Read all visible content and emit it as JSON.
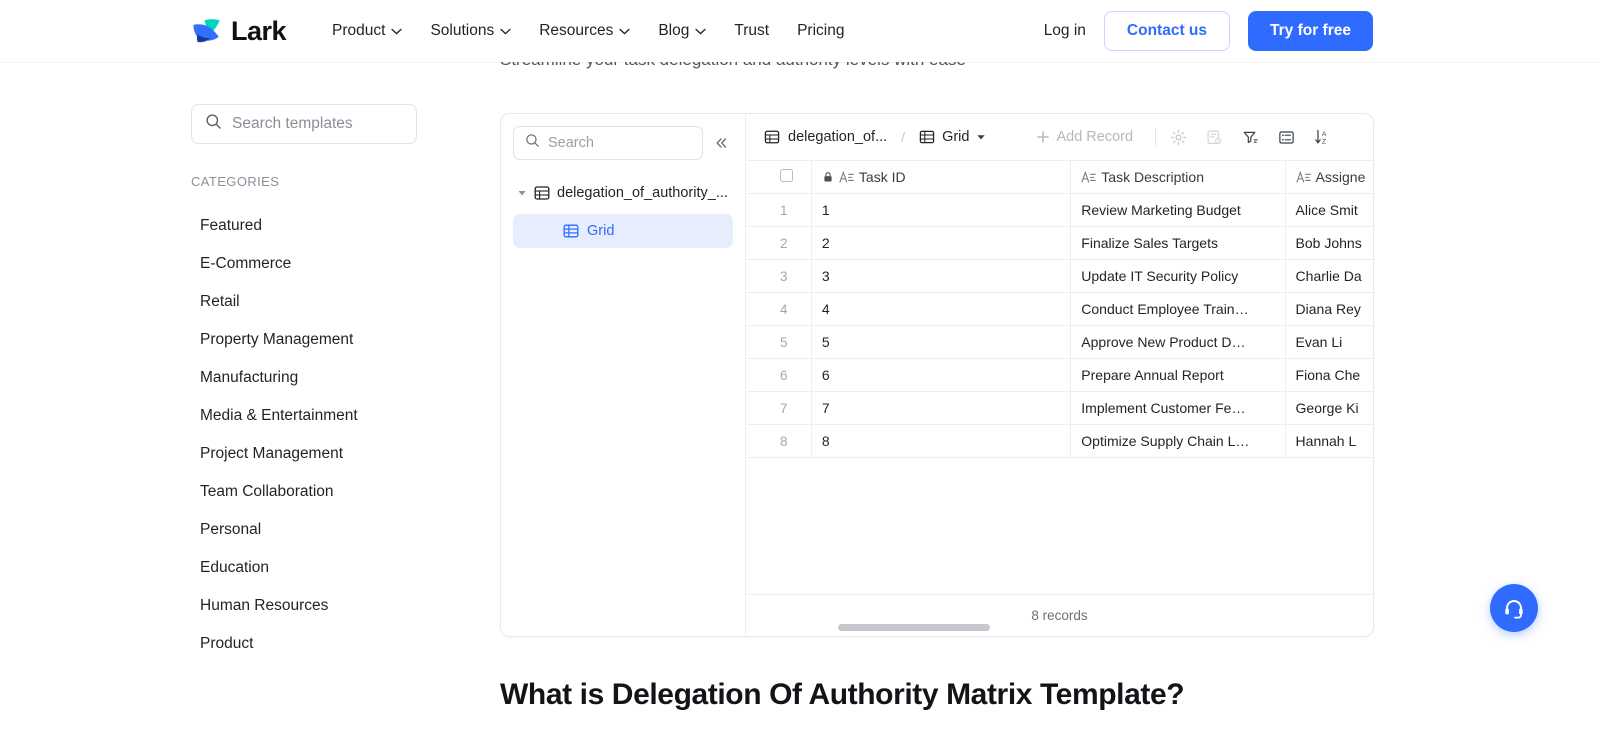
{
  "nav": {
    "brand": "Lark",
    "items": [
      {
        "label": "Product",
        "caret": true
      },
      {
        "label": "Solutions",
        "caret": true
      },
      {
        "label": "Resources",
        "caret": true
      },
      {
        "label": "Blog",
        "caret": true
      },
      {
        "label": "Trust",
        "caret": false
      },
      {
        "label": "Pricing",
        "caret": false
      }
    ],
    "login": "Log in",
    "contact": "Contact us",
    "try_free": "Try for free"
  },
  "hero": {
    "subheading": "Streamline your task delegation and authority levels with ease"
  },
  "sidebar": {
    "search_placeholder": "Search templates",
    "categories_label": "CATEGORIES",
    "items": [
      {
        "label": "Featured"
      },
      {
        "label": "E-Commerce"
      },
      {
        "label": "Retail"
      },
      {
        "label": "Property Management"
      },
      {
        "label": "Manufacturing"
      },
      {
        "label": "Media & Entertainment"
      },
      {
        "label": "Project Management"
      },
      {
        "label": "Team Collaboration"
      },
      {
        "label": "Personal"
      },
      {
        "label": "Education"
      },
      {
        "label": "Human Resources"
      },
      {
        "label": "Product"
      }
    ]
  },
  "embed": {
    "tree": {
      "search_placeholder": "Search",
      "collapse_icon": "chevron-double-left-icon",
      "table_node": "delegation_of_authority_...",
      "view_node": "Grid"
    },
    "toolbar": {
      "file_name": "delegation_of...",
      "separator": "/",
      "view_name": "Grid",
      "add_record": "Add Record",
      "icons": [
        "gear-icon",
        "form-settings-icon",
        "filter-icon",
        "row-height-icon",
        "sort-az-icon"
      ]
    },
    "grid": {
      "columns": [
        {
          "key": "select",
          "label": ""
        },
        {
          "key": "task_id",
          "label": "Task ID",
          "locked": true,
          "type_icon": "text-field-icon"
        },
        {
          "key": "task_description",
          "label": "Task Description",
          "locked": false,
          "type_icon": "text-field-icon"
        },
        {
          "key": "assignee",
          "label": "Assigne",
          "locked": false,
          "type_icon": "text-field-icon"
        }
      ],
      "rows": [
        {
          "n": "1",
          "task_id": "1",
          "task_description": "Review Marketing Budget",
          "assignee": "Alice Smit"
        },
        {
          "n": "2",
          "task_id": "2",
          "task_description": "Finalize Sales Targets",
          "assignee": "Bob Johns"
        },
        {
          "n": "3",
          "task_id": "3",
          "task_description": "Update IT Security Policy",
          "assignee": "Charlie Da"
        },
        {
          "n": "4",
          "task_id": "4",
          "task_description": "Conduct Employee Train…",
          "assignee": "Diana Rey"
        },
        {
          "n": "5",
          "task_id": "5",
          "task_description": "Approve New Product D…",
          "assignee": "Evan Li"
        },
        {
          "n": "6",
          "task_id": "6",
          "task_description": "Prepare Annual Report",
          "assignee": "Fiona Che"
        },
        {
          "n": "7",
          "task_id": "7",
          "task_description": "Implement Customer Fe…",
          "assignee": "George Ki"
        },
        {
          "n": "8",
          "task_id": "8",
          "task_description": "Optimize Supply Chain L…",
          "assignee": "Hannah L"
        }
      ],
      "record_count": "8 records"
    }
  },
  "section": {
    "title": "What is Delegation Of Authority Matrix Template?"
  },
  "fab": {
    "icon": "support-headset-icon"
  },
  "colors": {
    "accent": "#2f6bff",
    "brand_teal": "#00d6b9",
    "text": "#1f2329",
    "muted": "#8a9099",
    "selected_bg": "#e7edfd"
  }
}
